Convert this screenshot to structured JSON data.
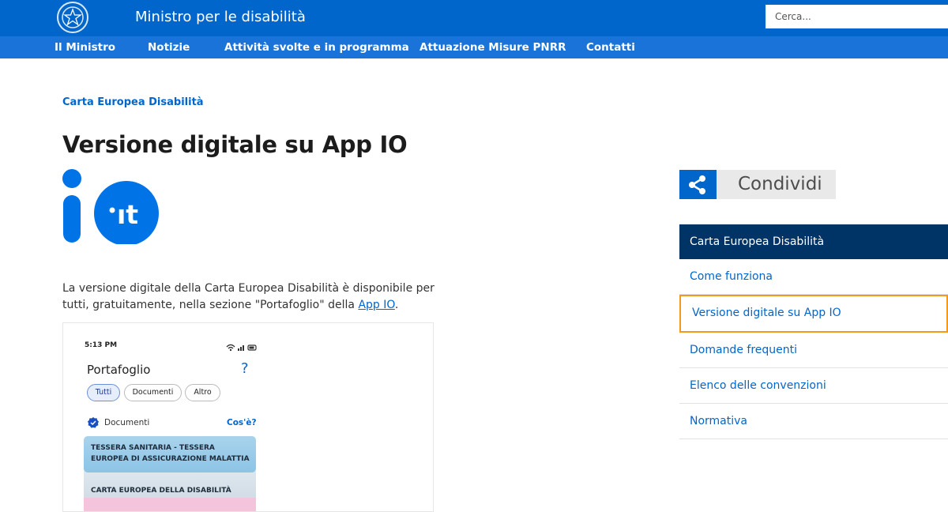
{
  "header": {
    "site_title": "Ministro per le disabilità",
    "search_placeholder": "Cerca...",
    "emblem_icon": "italian-republic-emblem-icon"
  },
  "nav": {
    "items": [
      "Il Ministro",
      "Notizie",
      "Attività svolte e in programma",
      "Attuazione Misure PNRR",
      "Contatti"
    ]
  },
  "breadcrumb": "Carta Europea Disabilità",
  "page_title": "Versione digitale su App IO",
  "io_logo": {
    "icon": "io-app-logo-icon",
    "mark_text": "ıt",
    "color": "#0073e6"
  },
  "intro": {
    "text_before": "La versione digitale della Carta Europea Disabilità è disponibile per tutti, gratuitamente, nella sezione \"Portafoglio\" della ",
    "link": "App IO",
    "text_after": "."
  },
  "phone_screenshot": {
    "time": "5:13 PM",
    "title": "Portafoglio",
    "help": "?",
    "chips": [
      "Tutti",
      "Documenti",
      "Altro"
    ],
    "active_chip": "Tutti",
    "section_label": "Documenti",
    "section_link": "Cos'è?",
    "cards": [
      {
        "line1": "TESSERA SANITARIA - TESSERA",
        "line2": "EUROPEA DI ASSICURAZIONE MALATTIA"
      },
      {
        "line1": "CARTA EUROPEA DELLA DISABILITÀ",
        "line2": ""
      }
    ]
  },
  "share": {
    "label": "Condividi",
    "icon": "share-icon"
  },
  "sidebar": {
    "heading": "Carta Europea Disabilità",
    "items": [
      "Come funziona",
      "Versione digitale su App IO",
      "Domande frequenti",
      "Elenco delle convenzioni",
      "Normativa"
    ],
    "current": "Versione digitale su App IO"
  },
  "colors": {
    "header_bg": "#0066cc",
    "nav_bg": "#1a73d8",
    "sidebar_head_bg": "#003366",
    "current_outline": "#f39a1e",
    "link": "#0066cc"
  }
}
